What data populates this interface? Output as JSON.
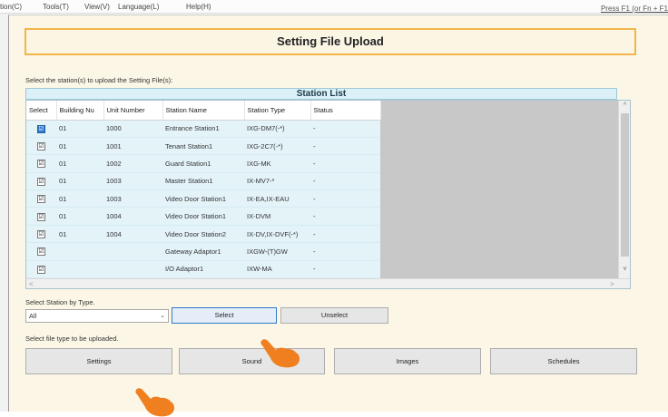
{
  "menu": {
    "items": [
      "tion(C)",
      "Tools(T)",
      "View(V)",
      "Language(L)",
      "Help(H)"
    ],
    "help_hint": "Press F1 (or Fn + F1"
  },
  "title": "Setting File Upload",
  "instructions": {
    "select_stations": "Select the station(s) to upload the Setting File(s):",
    "select_by_type": "Select Station by Type.",
    "file_type": "Select file type to be uploaded."
  },
  "station_list": {
    "title": "Station List",
    "columns": [
      "Select",
      "Building Nu",
      "Unit Number",
      "Station Name",
      "Station Type",
      "Status"
    ],
    "rows": [
      {
        "checked": true,
        "building": "01",
        "unit": "1000",
        "name": "Entrance Station1",
        "type": "IXG-DM7(-*)",
        "status": "-"
      },
      {
        "checked": true,
        "building": "01",
        "unit": "1001",
        "name": "Tenant Station1",
        "type": "IXG-2C7(-*)",
        "status": "-"
      },
      {
        "checked": true,
        "building": "01",
        "unit": "1002",
        "name": "Guard Station1",
        "type": "IXG-MK",
        "status": "-"
      },
      {
        "checked": true,
        "building": "01",
        "unit": "1003",
        "name": "Master Station1",
        "type": "IX-MV7-*",
        "status": "-"
      },
      {
        "checked": true,
        "building": "01",
        "unit": "1003",
        "name": "Video Door Station1",
        "type": "IX-EA,IX-EAU",
        "status": "-"
      },
      {
        "checked": true,
        "building": "01",
        "unit": "1004",
        "name": "Video Door Station1",
        "type": "IX-DVM",
        "status": "-"
      },
      {
        "checked": true,
        "building": "01",
        "unit": "1004",
        "name": "Video Door Station2",
        "type": "IX-DV,IX-DVF(-*)",
        "status": "-"
      },
      {
        "checked": true,
        "building": "",
        "unit": "",
        "name": "Gateway Adaptor1",
        "type": "IXGW-(T)GW",
        "status": "-"
      },
      {
        "checked": true,
        "building": "",
        "unit": "",
        "name": "I/O Adaptor1",
        "type": "IXW-MA",
        "status": "-"
      }
    ]
  },
  "station_type_select": {
    "value": "All"
  },
  "buttons": {
    "select": "Select",
    "unselect": "Unselect",
    "settings": "Settings",
    "sound": "Sound",
    "images": "Images",
    "schedules": "Schedules"
  },
  "icons": {
    "checkbox_mark": "☑",
    "scroll_up": "^",
    "scroll_down": "v",
    "scroll_left": "<",
    "scroll_right": ">",
    "dropdown": "⌄"
  },
  "colors": {
    "title_border": "#f3b54a",
    "window_bg": "#fbf6e6",
    "table_bg": "#e3f3f8",
    "focus_blue": "#2f7ac7",
    "pointer_orange": "#f07f1f"
  }
}
